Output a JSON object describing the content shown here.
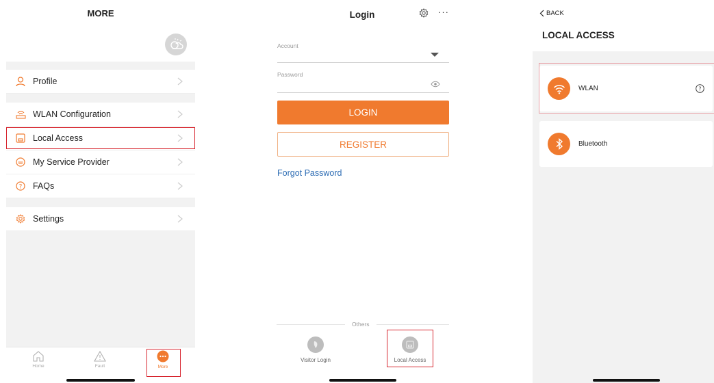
{
  "more_screen": {
    "title": "MORE",
    "menu": [
      {
        "label": "Profile",
        "icon": "person-icon"
      },
      {
        "label": "WLAN Configuration",
        "icon": "router-icon"
      },
      {
        "label": "Local Access",
        "icon": "local-access-icon"
      },
      {
        "label": "My Service Provider",
        "icon": "service-provider-icon"
      },
      {
        "label": "FAQs",
        "icon": "question-icon"
      },
      {
        "label": "Settings",
        "icon": "gear-icon"
      }
    ],
    "tabs": [
      {
        "label": "Home",
        "icon": "home-icon"
      },
      {
        "label": "Fault",
        "icon": "warning-icon"
      },
      {
        "label": "More",
        "icon": "more-dots-icon"
      }
    ]
  },
  "login_screen": {
    "title": "Login",
    "account_label": "Account",
    "password_label": "Password",
    "login_button": "LOGIN",
    "register_button": "REGISTER",
    "forgot_password": "Forgot Password",
    "others_label": "Others",
    "visitor_login": "Visitor Login",
    "local_access": "Local Access"
  },
  "local_access_screen": {
    "back_label": "BACK",
    "title": "LOCAL ACCESS",
    "options": [
      {
        "label": "WLAN",
        "icon": "wifi-icon"
      },
      {
        "label": "Bluetooth",
        "icon": "bluetooth-icon"
      }
    ]
  },
  "colors": {
    "accent": "#f07a2e",
    "highlight": "#d7262f",
    "link": "#2e6db4"
  }
}
